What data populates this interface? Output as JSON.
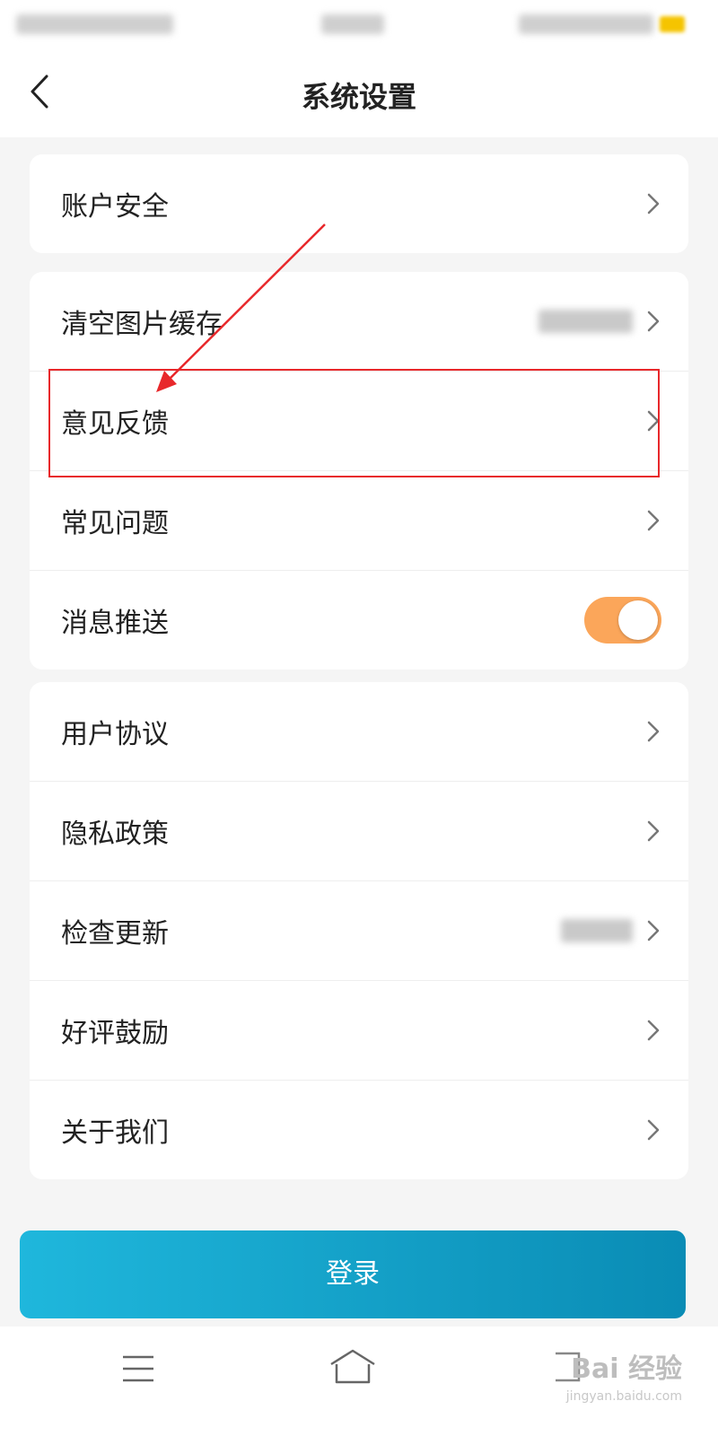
{
  "header": {
    "title": "系统设置"
  },
  "groups": [
    {
      "items": [
        {
          "label": "账户安全"
        }
      ]
    },
    {
      "items": [
        {
          "label": "清空图片缓存"
        },
        {
          "label": "意见反馈"
        },
        {
          "label": "常见问题"
        },
        {
          "label": "消息推送",
          "toggle_on": true
        }
      ]
    },
    {
      "items": [
        {
          "label": "用户协议"
        },
        {
          "label": "隐私政策"
        },
        {
          "label": "检查更新"
        },
        {
          "label": "好评鼓励"
        },
        {
          "label": "关于我们"
        }
      ]
    }
  ],
  "login_button": {
    "label": "登录"
  },
  "watermark": {
    "brand": "Bai 经验",
    "url": "jingyan.baidu.com"
  },
  "colors": {
    "toggle_on": "#fba65a",
    "login_gradient_start": "#1fb7dc",
    "login_gradient_end": "#0a8cb5",
    "annotation": "#e8282b"
  },
  "icons": {
    "back": "chevron-left-icon",
    "row_chevron": "chevron-right-icon",
    "nav_menu": "menu-icon",
    "nav_home": "home-icon",
    "nav_back": "back-nav-icon"
  }
}
